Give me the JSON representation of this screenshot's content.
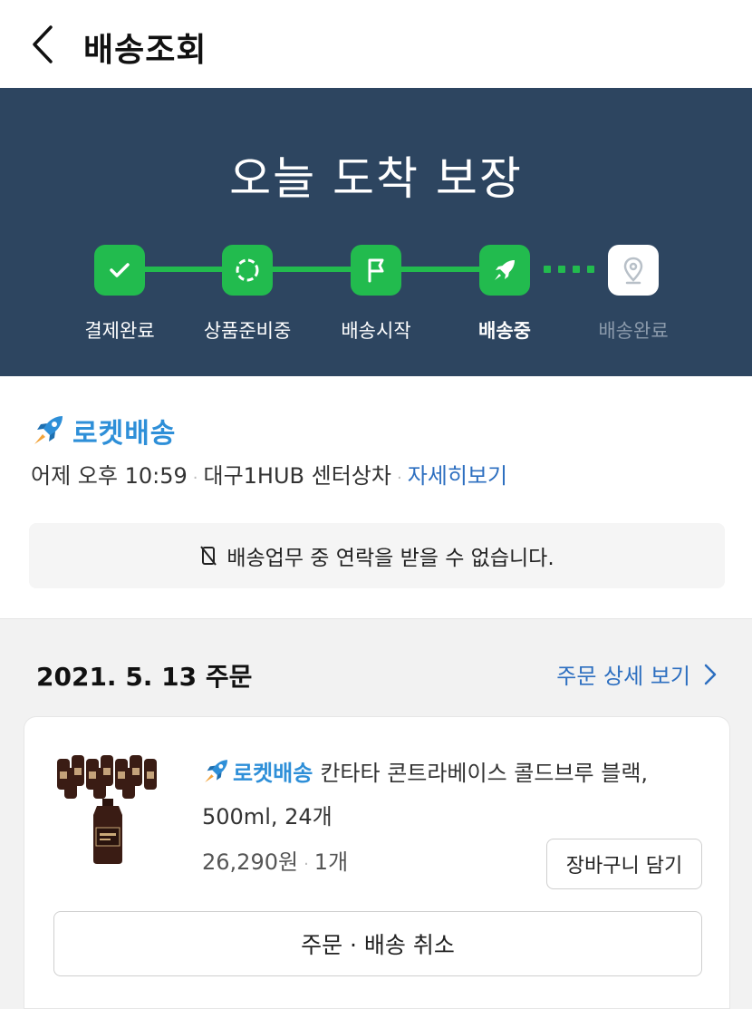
{
  "header": {
    "title": "배송조회"
  },
  "banner": {
    "title": "오늘 도착 보장",
    "steps": [
      {
        "label": "결제완료",
        "icon": "check-icon",
        "state": "done"
      },
      {
        "label": "상품준비중",
        "icon": "dashed-circle-icon",
        "state": "done"
      },
      {
        "label": "배송시작",
        "icon": "flag-icon",
        "state": "done"
      },
      {
        "label": "배송중",
        "icon": "rocket-icon",
        "state": "current"
      },
      {
        "label": "배송완료",
        "icon": "location-pin-icon",
        "state": "pending"
      }
    ],
    "colors": {
      "background": "#2d4560",
      "active": "#22bb4e",
      "inactive_label": "#8b9aab"
    }
  },
  "delivery": {
    "service": "로켓배송",
    "time": "어제 오후 10:59",
    "location": "대구1HUB 센터상차",
    "detail_link": "자세히보기",
    "notice": "배송업무 중 연락을 받을 수 없습니다."
  },
  "order": {
    "date": "2021. 5. 13 주문",
    "detail_link": "주문 상세 보기",
    "item": {
      "badge": "로켓배송",
      "name_line1": "칸타타 콘트라베이스 콜드브루 블랙,",
      "name_line2": "500ml, 24개",
      "price": "26,290원",
      "quantity": "1개"
    },
    "cart_button": "장바구니 담기",
    "cancel_button": "주문 · 배송 취소"
  }
}
